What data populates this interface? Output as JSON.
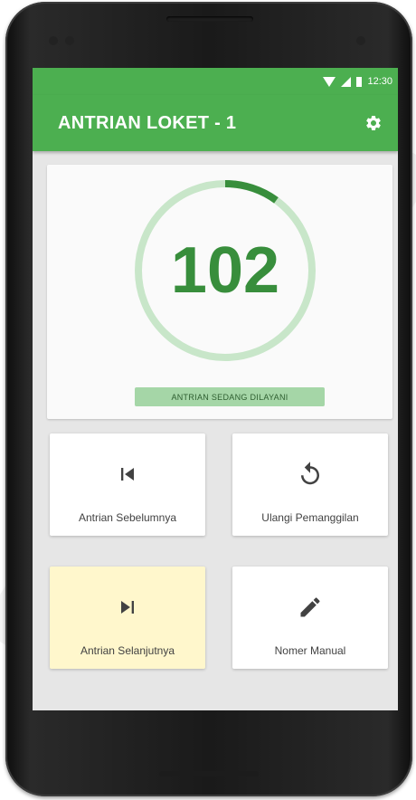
{
  "status_bar": {
    "time": "12:30",
    "icons": [
      "wifi-icon",
      "signal-icon",
      "battery-icon"
    ]
  },
  "app_bar": {
    "title": "ANTRIAN LOKET - 1",
    "action_icon": "settings-icon"
  },
  "queue": {
    "current_number": "102",
    "status_label": "ANTRIAN SEDANG DILAYANI",
    "progress_fraction": 0.1
  },
  "actions": [
    {
      "label": "Antrian Sebelumnya",
      "icon": "skip-previous-icon"
    },
    {
      "label": "Ulangi Pemanggilan",
      "icon": "replay-icon"
    },
    {
      "label": "Antrian Selanjutnya",
      "icon": "skip-next-icon",
      "highlight": "#fff7cc"
    },
    {
      "label": "Nomer Manual",
      "icon": "edit-icon"
    }
  ],
  "colors": {
    "primary": "#4caf50",
    "primary_dark": "#388e3c",
    "ring_track": "#c8e6c9",
    "pill_bg": "#a5d6a7",
    "screen_bg": "#e6e6e6",
    "highlight": "#fff7cc"
  }
}
